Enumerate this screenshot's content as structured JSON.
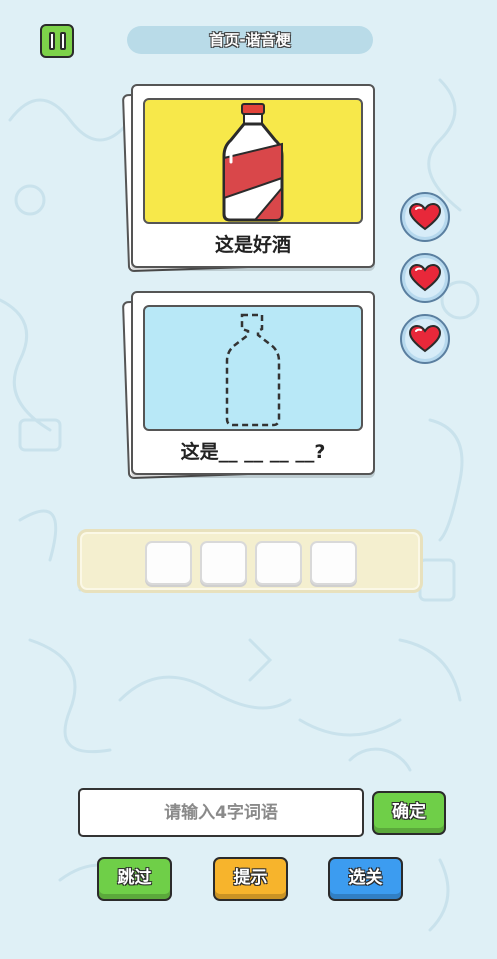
{
  "header": {
    "title": "首页-谐音梗",
    "pause_icon": "pause-icon"
  },
  "colors": {
    "background": "#dff0f6",
    "accent_green": "#6fcf48",
    "accent_orange": "#f7b42c",
    "accent_blue": "#3c9cf0",
    "clue_panel": "#f7e84a",
    "guess_panel": "#b8e8f7"
  },
  "clue_card": {
    "image": "red-white-liquor-bottle",
    "caption": "这是好酒"
  },
  "guess_card": {
    "image": "dashed-bottle-outline",
    "caption": "这是__ __ __ __?"
  },
  "lives": {
    "count": 3,
    "icon": "heart-icon"
  },
  "answer": {
    "slots": [
      "",
      "",
      "",
      ""
    ]
  },
  "input": {
    "placeholder": "请输入4字词语",
    "value": ""
  },
  "buttons": {
    "confirm": "确定",
    "skip": "跳过",
    "hint": "提示",
    "select_level": "选关"
  }
}
